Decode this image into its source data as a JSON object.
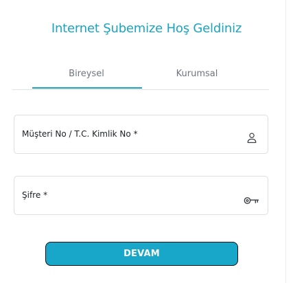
{
  "page": {
    "title": "Internet Şubemize Hoş Geldiniz"
  },
  "tabs": [
    {
      "label": "Bireysel",
      "active": true
    },
    {
      "label": "Kurumsal",
      "active": false
    }
  ],
  "form": {
    "customer_number": {
      "label": "Müşteri No / T.C. Kimlik No",
      "required_marker": "*",
      "icon": "user-icon"
    },
    "password": {
      "label": "Şifre",
      "required_marker": "*",
      "icon": "key-icon"
    },
    "submit_label": "DEVAM"
  },
  "colors": {
    "accent": "#1aa4c4",
    "button": "#19a7c9",
    "text": "#1b1f24",
    "muted": "#6e7480",
    "border": "#dedede"
  }
}
